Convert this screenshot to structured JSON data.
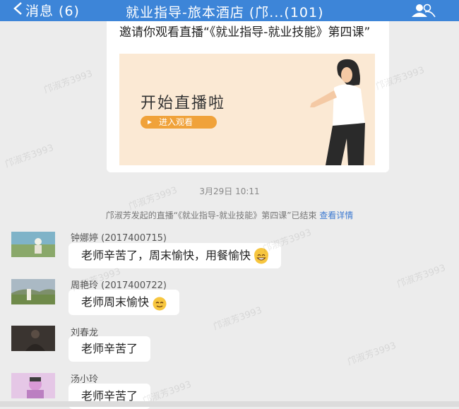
{
  "header": {
    "back_label": "消息 (6)",
    "title": "就业指导-旅本酒店 (邝...(101)",
    "icons": {
      "back": "chevron-left-icon",
      "members": "group-icon"
    }
  },
  "live_card": {
    "text": "邀请你观看直播“《就业指导-就业技能》第四课”",
    "poster_title": "开始直播啦",
    "poster_button": "进入观看"
  },
  "timestamp": "3月29日 10:11",
  "system_message": {
    "text": "邝淑芳发起的直播“《就业指导-就业技能》第四课”已结束",
    "link": "查看详情"
  },
  "messages": [
    {
      "sender": "钟娜婷 (2017400715)",
      "text": "老师辛苦了，周末愉快，用餐愉快",
      "emoji": "grin-emoji"
    },
    {
      "sender": "周艳玲 (2017400722)",
      "text": "老师周末愉快",
      "emoji": "smile-emoji"
    },
    {
      "sender": "刘春龙",
      "text": "老师辛苦了",
      "emoji": ""
    },
    {
      "sender": "汤小玲",
      "text": "老师辛苦了",
      "emoji": ""
    }
  ],
  "watermark": "邝淑芳3993",
  "colors": {
    "header": "#3d85d8",
    "background": "#ececec",
    "link": "#3d7ad1",
    "poster": "#fbe9d4",
    "poster_button": "#f0a23a"
  }
}
